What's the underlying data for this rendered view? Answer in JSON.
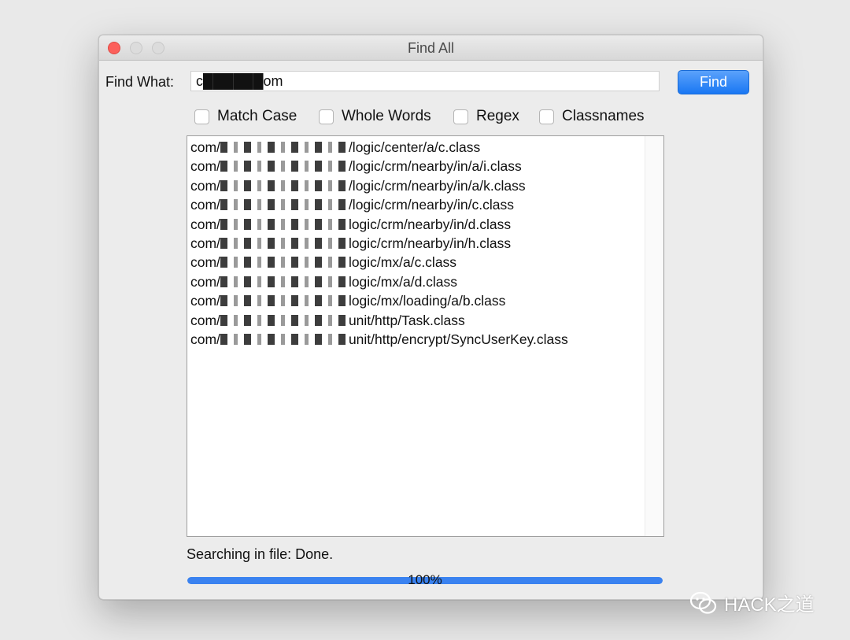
{
  "window": {
    "title": "Find All"
  },
  "search": {
    "label": "Find What:",
    "value": "c██████om",
    "find_button": "Find"
  },
  "options": [
    {
      "label": "Match Case",
      "checked": false
    },
    {
      "label": "Whole Words",
      "checked": false
    },
    {
      "label": "Regex",
      "checked": false
    },
    {
      "label": "Classnames",
      "checked": false
    }
  ],
  "results": [
    {
      "prefix": "com/",
      "path": "/logic/center/a/c.class"
    },
    {
      "prefix": "com/",
      "path": "/logic/crm/nearby/in/a/i.class"
    },
    {
      "prefix": "com/",
      "path": "/logic/crm/nearby/in/a/k.class"
    },
    {
      "prefix": "com/",
      "path": "/logic/crm/nearby/in/c.class"
    },
    {
      "prefix": "com/",
      "path": "logic/crm/nearby/in/d.class"
    },
    {
      "prefix": "com/",
      "path": "logic/crm/nearby/in/h.class"
    },
    {
      "prefix": "com/",
      "path": "logic/mx/a/c.class"
    },
    {
      "prefix": "com/",
      "path": "logic/mx/a/d.class"
    },
    {
      "prefix": "com/",
      "path": "logic/mx/loading/a/b.class"
    },
    {
      "prefix": "com/",
      "path": "unit/http/Task.class"
    },
    {
      "prefix": "com/",
      "path": "unit/http/encrypt/SyncUserKey.class"
    }
  ],
  "status": "Searching in file: Done.",
  "progress": {
    "percent": 100,
    "label": "100%",
    "color": "#3a82f0"
  },
  "watermark": "HACK之道"
}
